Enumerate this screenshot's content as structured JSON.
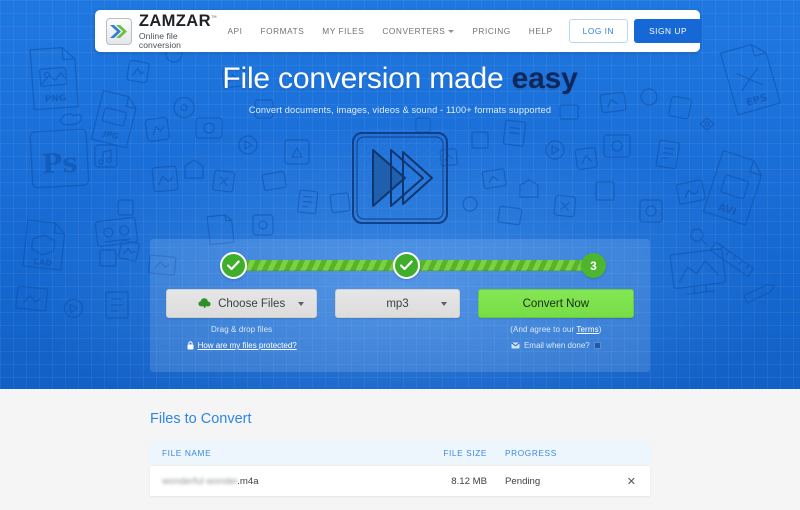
{
  "header": {
    "logo_name": "ZAMZAR",
    "logo_tm": "™",
    "logo_tagline": "Online file conversion",
    "logo_icon": "double-chevron-icon",
    "nav": [
      {
        "label": "API",
        "has_caret": false
      },
      {
        "label": "FORMATS",
        "has_caret": false
      },
      {
        "label": "MY FILES",
        "has_caret": false
      },
      {
        "label": "CONVERTERS",
        "has_caret": true
      },
      {
        "label": "PRICING",
        "has_caret": false
      },
      {
        "label": "HELP",
        "has_caret": false
      }
    ],
    "login_label": "LOG IN",
    "signup_label": "SIGN UP"
  },
  "hero": {
    "title_plain": "File conversion made ",
    "title_accent": "easy",
    "subtitle": "Convert documents, images, videos & sound - 1100+ formats supported",
    "center_art": "fast-forward-play-sketch"
  },
  "widget": {
    "steps": [
      {
        "state": "done",
        "mark": "✓"
      },
      {
        "state": "done",
        "mark": "✓"
      },
      {
        "state": "current",
        "mark": "3"
      }
    ],
    "choose_files_label": "Choose Files",
    "choose_files_icon": "cloud-upload-icon",
    "format_value": "mp3",
    "convert_label": "Convert Now",
    "drag_drop_text": "Drag & drop files",
    "protected_link": "How are my files protected?",
    "protected_icon": "lock-icon",
    "terms_prefix": "(And agree to our ",
    "terms_link": "Terms",
    "terms_suffix": ")",
    "email_icon": "envelope-icon",
    "email_label": "Email when done?",
    "email_checked": false
  },
  "files": {
    "title_plain": "Files to ",
    "title_accent": "Convert",
    "columns": [
      "FILE NAME",
      "FILE SIZE",
      "PROGRESS"
    ],
    "rows": [
      {
        "name": "wonderful wonder.m4a",
        "name_blurred": "wonderful wonder",
        "name_extension": ".m4a",
        "size": "8.12 MB",
        "progress": "Pending",
        "remove_icon": "close-icon"
      }
    ]
  },
  "colors": {
    "hero_blue": "#1b6fd8",
    "accent_blue": "#2f86e8",
    "signup_blue": "#1668d6",
    "green_progress": "#7ad142",
    "green_convert": "#77dd46",
    "title_dark": "#10275c",
    "page_bg": "#f5f5f6"
  }
}
